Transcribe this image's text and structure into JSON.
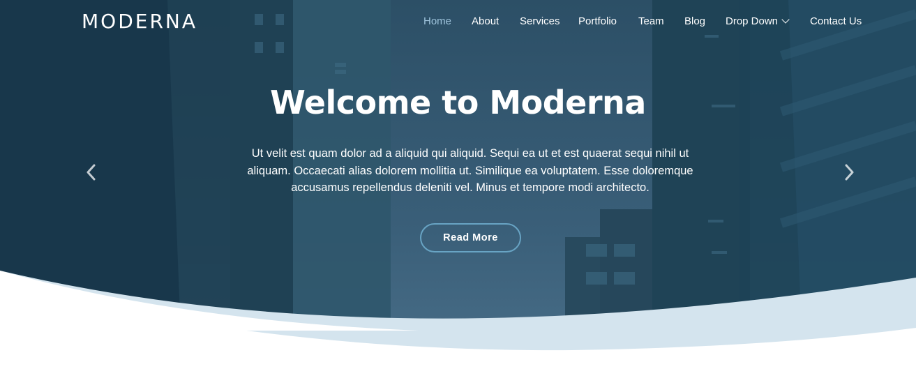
{
  "brand": {
    "logo": "MODERNA"
  },
  "nav": {
    "items": [
      {
        "label": "Home"
      },
      {
        "label": "About"
      },
      {
        "label": "Services"
      },
      {
        "label": "Portfolio"
      },
      {
        "label": "Team"
      },
      {
        "label": "Blog"
      },
      {
        "label": "Drop Down"
      },
      {
        "label": "Contact Us"
      }
    ]
  },
  "hero": {
    "title": "Welcome to Moderna",
    "description_lines": [
      "Ut velit est quam dolor ad a aliquid qui aliquid. Sequi ea ut et est quaerat sequi nihil ut",
      "aliquam. Occaecati alias dolorem mollitia ut. Similique ea voluptatem. Esse doloremque",
      "accusamus repellendus deleniti vel. Minus et tempore modi architecto."
    ],
    "button_label": "Read More"
  },
  "icons": {
    "prev": "chevron-left-icon",
    "next": "chevron-right-icon",
    "dropdown": "chevron-down-icon"
  },
  "colors": {
    "overlay": "#1e4356",
    "accent": "#68a4c4",
    "nav_active": "#9fc4dc",
    "wave_light": "#d4e4ee",
    "text": "#ffffff"
  }
}
